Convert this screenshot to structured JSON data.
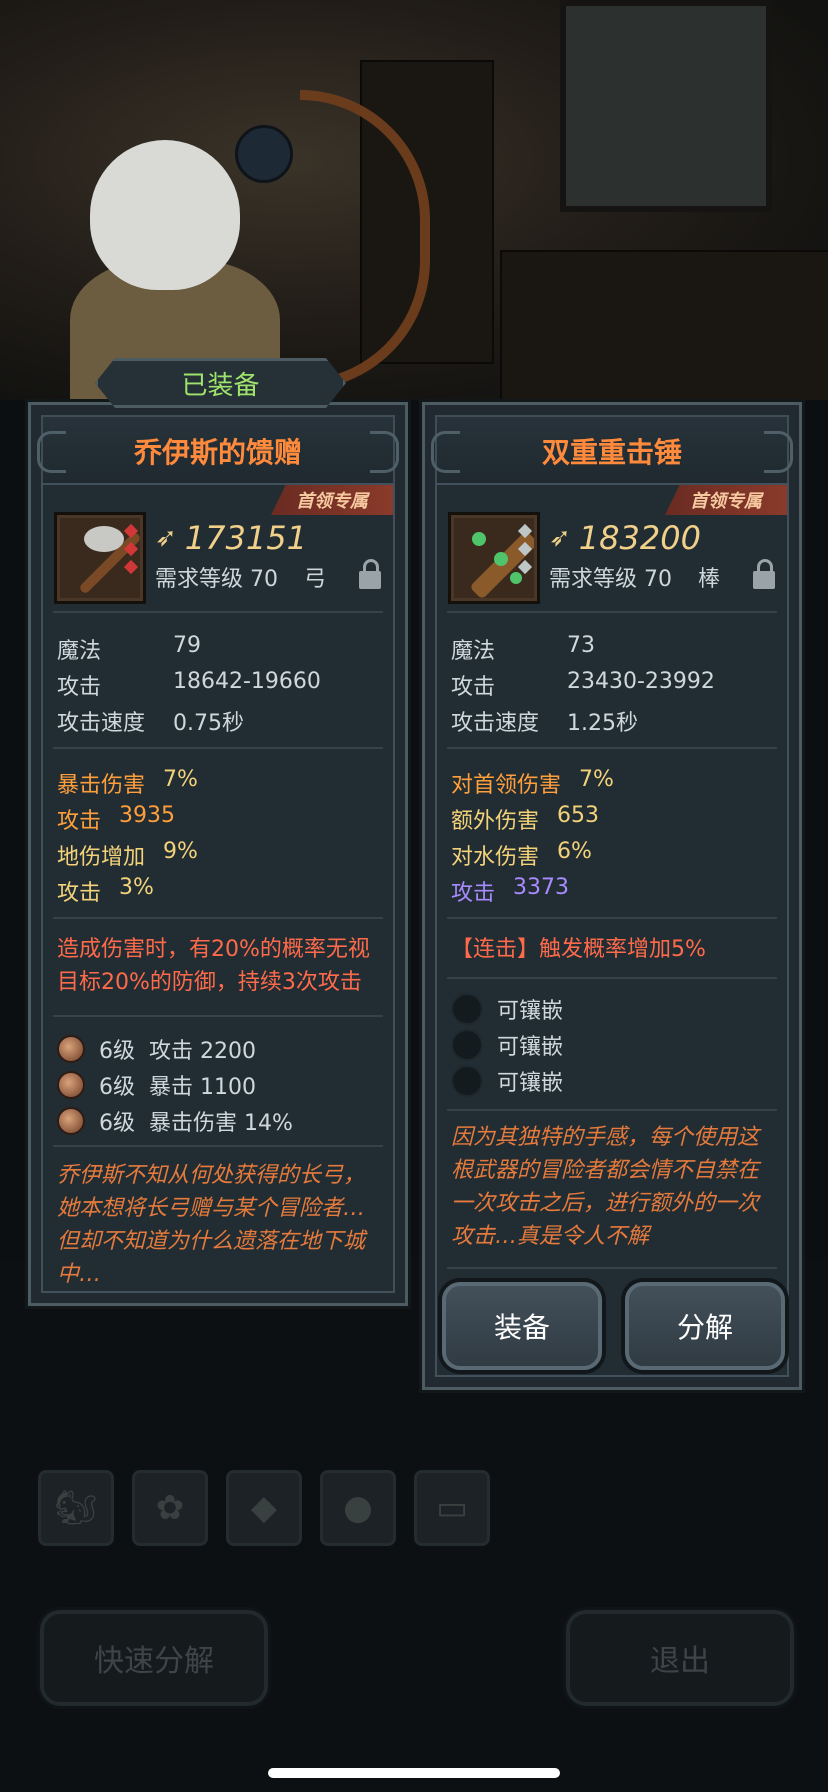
{
  "equipped_tag": "已装备",
  "left_item": {
    "name": "乔伊斯的馈赠",
    "boss_tag": "首领专属",
    "price": "173151",
    "req_level": "需求等级 70",
    "type": "弓",
    "base_stats": [
      {
        "label": "魔法",
        "value": "79"
      },
      {
        "label": "攻击",
        "value": "18642-19660"
      },
      {
        "label": "攻击速度",
        "value": "0.75秒"
      }
    ],
    "bonus_stats": [
      {
        "label": "暴击伤害",
        "value": "7%"
      },
      {
        "label": "攻击",
        "value": "3935"
      },
      {
        "label": "地伤增加",
        "value": "9%"
      },
      {
        "label": "攻击",
        "value": "3%"
      }
    ],
    "special": "造成伤害时，有20%的概率无视目标20%的防御，持续3次攻击",
    "gems": [
      {
        "level": "6级",
        "effect": "攻击 2200"
      },
      {
        "level": "6级",
        "effect": "暴击 1100"
      },
      {
        "level": "6级",
        "effect": "暴击伤害 14%"
      }
    ],
    "flavor": "乔伊斯不知从何处获得的长弓，她本想将长弓赠与某个冒险者…但却不知道为什么遗落在地下城中…"
  },
  "right_item": {
    "name": "双重重击锤",
    "boss_tag": "首领专属",
    "price": "183200",
    "req_level": "需求等级 70",
    "type": "棒",
    "base_stats": [
      {
        "label": "魔法",
        "value": "73"
      },
      {
        "label": "攻击",
        "value": "23430-23992"
      },
      {
        "label": "攻击速度",
        "value": "1.25秒"
      }
    ],
    "bonus_stats": [
      {
        "label": "对首领伤害",
        "value": "7%"
      },
      {
        "label": "额外伤害",
        "value": "653"
      },
      {
        "label": "对水伤害",
        "value": "6%"
      },
      {
        "label": "攻击",
        "value": "3373"
      }
    ],
    "special": "【连击】触发概率增加5%",
    "sockets": [
      "可镶嵌",
      "可镶嵌",
      "可镶嵌"
    ],
    "flavor": "因为其独特的手感，每个使用这根武器的冒险者都会情不自禁在一次攻击之后，进行额外的一次攻击…真是令人不解",
    "equip_label": "装备",
    "dismantle_label": "分解"
  },
  "bottom": {
    "quick_dismantle": "快速分解",
    "exit": "退出"
  },
  "category_icons": [
    "squirrel-icon",
    "paw-icon",
    "diamond-icon",
    "ore-icon",
    "chest-icon"
  ]
}
